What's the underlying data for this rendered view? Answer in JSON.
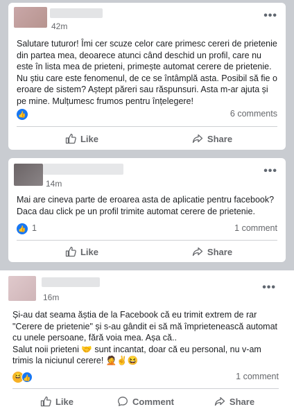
{
  "posts": [
    {
      "time": "42m",
      "text": "Salutare tuturor! Îmi cer scuze celor care primesc cereri de prietenie din partea mea, deoarece atunci când deschid un profil, care nu este în lista mea de prieteni, primește automat cerere de prietenie.  Nu știu care este fenomenul, de ce se întâmplă asta.  Posibil să fie o eroare de sistem? Aștept păreri sau răspunsuri. Asta m-ar ajuta și pe mine. Mulțumesc frumos pentru înțelegere!",
      "reaction_count": "",
      "comments": "6 comments",
      "actions": {
        "like": "Like",
        "share": "Share"
      }
    },
    {
      "time": "14m",
      "text": "Mai are cineva parte de eroarea asta de aplicatie pentru facebook? Daca dau click pe un profil trimite automat cerere de prietenie.",
      "reaction_count": "1",
      "comments": "1 comment",
      "actions": {
        "like": "Like",
        "share": "Share"
      }
    },
    {
      "time": "16m",
      "text_lines": [
        "Și-au dat seama ăștia de la Facebook că eu trimit extrem de rar \"Cerere de prietenie\" și s-au gândit ei să mă împrietenească automat cu unele persoane, fără voia mea. Așa că..",
        "Salut noii prieteni 🤝 sunt incantat, doar că eu personal, nu v-am trimis la niciunul cerere! 🤦✌😆"
      ],
      "comments": "1 comment",
      "actions": {
        "like": "Like",
        "comment": "Comment",
        "share": "Share"
      }
    }
  ],
  "icons": {
    "like": "thumbs-up-icon",
    "share": "share-arrow-icon",
    "comment": "speech-bubble-icon",
    "more": "more-dots-icon"
  },
  "colors": {
    "fb_blue": "#1877f2",
    "muted": "#65676b",
    "background": "#c9ccd1"
  }
}
